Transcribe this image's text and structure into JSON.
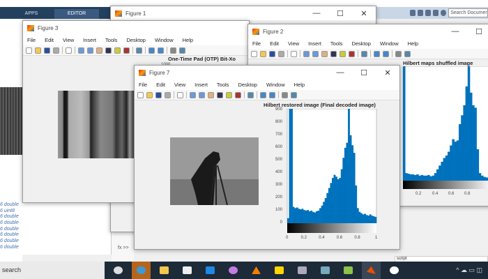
{
  "ribbon": {
    "tabs": [
      "APPS",
      "EDITOR"
    ],
    "search_placeholder": "Search Documen"
  },
  "menu": [
    "File",
    "Edit",
    "View",
    "Insert",
    "Tools",
    "Desktop",
    "Window",
    "Help"
  ],
  "figure1": {
    "title": "Figure 1"
  },
  "figure3": {
    "title": "Figure 3",
    "axes_title": "One-Time Pad (OTP) Bit-Xo",
    "ytick_top": "1000"
  },
  "figure2": {
    "title": "Figure 2",
    "axes_title": "Hilbert maps shuffled image",
    "xticks": [
      "0.2",
      "0.4",
      "0.6",
      "0.8"
    ]
  },
  "figure7": {
    "title": "Figure 7",
    "axes_title": "Hilbert restored image (Final decoded image)",
    "yticks": [
      "0",
      "100",
      "200",
      "300",
      "400",
      "500",
      "600",
      "700",
      "800",
      "900"
    ],
    "xticks": [
      "0",
      "0.2",
      "0.4",
      "0.6",
      "0.8",
      "1"
    ]
  },
  "chart_data": {
    "type": "bar",
    "title": "Hilbert restored image (Final decoded image)",
    "xlim": [
      0,
      1
    ],
    "ylim": [
      0,
      910
    ],
    "values": [
      40,
      910,
      910,
      130,
      120,
      125,
      115,
      110,
      115,
      105,
      100,
      105,
      95,
      100,
      90,
      85,
      95,
      100,
      120,
      140,
      170,
      200,
      240,
      280,
      320,
      360,
      385,
      370,
      350,
      360,
      430,
      520,
      600,
      640,
      910,
      700,
      620,
      560,
      300,
      120,
      90,
      80,
      70,
      75,
      65,
      60,
      70,
      60,
      55,
      50
    ]
  },
  "hist2_values": [
    910,
    60,
    55,
    50,
    50,
    45,
    50,
    40,
    45,
    40,
    40,
    45,
    35,
    40,
    60,
    90,
    120,
    150,
    180,
    200,
    230,
    280,
    330,
    310,
    320,
    450,
    520,
    600,
    750,
    910,
    700,
    600,
    580,
    250,
    60,
    40,
    30,
    25,
    20,
    15
  ],
  "workspace": {
    "rows": [
      "6 double",
      "6 uint8",
      "6 double",
      "6 double",
      "6 double",
      "6 double",
      "6 double",
      "6 double"
    ]
  },
  "command": {
    "prompt": "fx >>"
  },
  "status": {
    "script": "script"
  },
  "taskbar": {
    "search": "search"
  },
  "colors": {
    "hist": "#0072bd",
    "ribbon": "#23415f"
  }
}
